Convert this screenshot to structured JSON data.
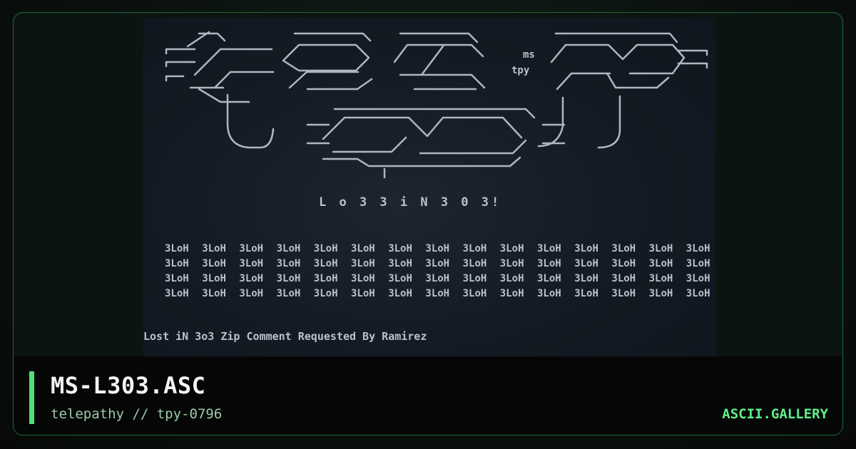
{
  "card": {
    "title": "MS-L303.ASC",
    "subtitle": "telepathy // tpy-0796",
    "brand": "ASCII.GALLERY"
  },
  "artwork": {
    "logo_tags": {
      "ms": "ms",
      "tpy": "tpy"
    },
    "caption": "L o 3 3   i N   3 0 3!",
    "repeat_word": "3LoH",
    "repeat_rows": 4,
    "repeat_cols": 15,
    "credit": "Lost iN 3o3 Zip Comment Requested By Ramirez"
  },
  "colors": {
    "accent": "#4fe07a",
    "brand": "#5ff08a",
    "frame_border": "#1f6b3a",
    "ascii_fg": "#b9c2cc"
  }
}
